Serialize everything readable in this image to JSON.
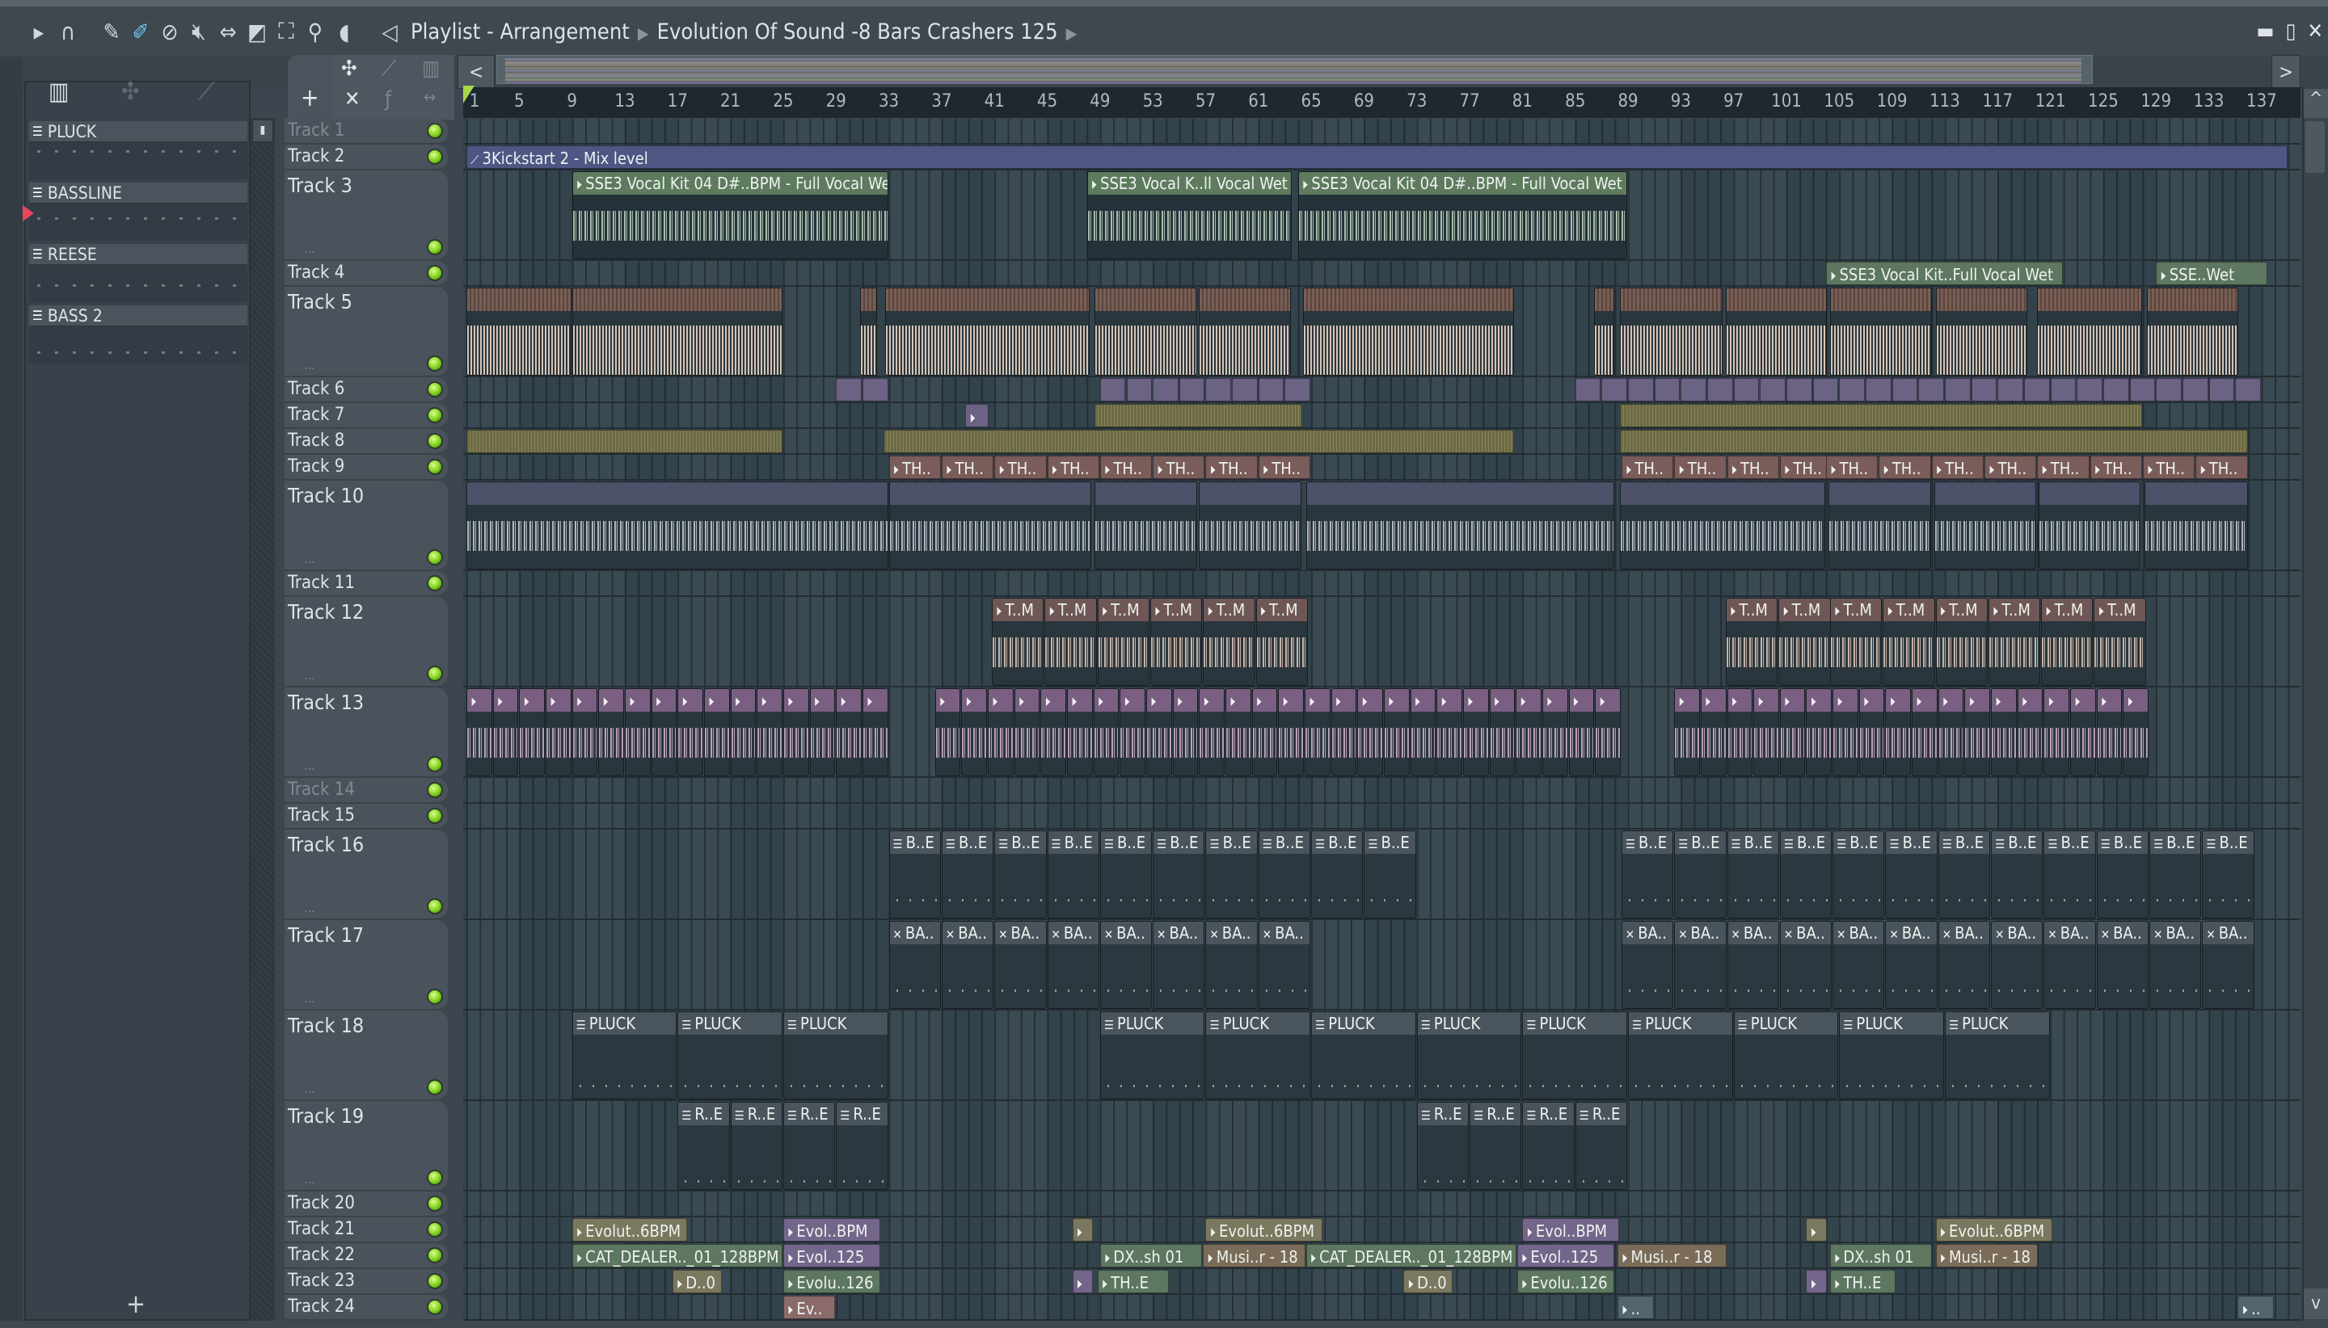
{
  "titlebar": {
    "title": "Playlist - Arrangement",
    "project": "Evolution Of Sound -8 Bars Crashers 125",
    "tools": [
      "play-icon",
      "magnet-icon",
      "pencil-icon",
      "paint-icon",
      "delete-icon",
      "mute-icon",
      "slip-icon",
      "slice-icon",
      "select-icon",
      "zoom-icon",
      "playback-icon"
    ],
    "window_buttons": [
      "minimize",
      "maximize",
      "close"
    ]
  },
  "pattern_picker": {
    "patterns": [
      {
        "name": "PLUCK"
      },
      {
        "name": "BASSLINE",
        "selected": true
      },
      {
        "name": "REESE"
      },
      {
        "name": "BASS 2"
      }
    ],
    "add_label": "+"
  },
  "toolbar2": {
    "add_label": "+",
    "scroll_left": "<",
    "scroll_right": ">"
  },
  "ruler": {
    "bars": [
      1,
      5,
      9,
      13,
      17,
      21,
      25,
      29,
      33,
      37,
      41,
      45,
      49,
      53,
      57,
      61,
      65,
      69,
      73,
      77,
      81,
      85,
      89,
      93,
      97,
      101,
      105,
      109,
      113,
      117,
      121,
      125,
      129,
      133,
      137
    ],
    "playhead_bar": 1
  },
  "colors": {
    "vocal": [
      "#5e7b5e",
      "#24323a",
      "#bed5bd"
    ],
    "auto": [
      "#4e5784",
      "#4e5784",
      "#4e5784"
    ],
    "kick": [
      "#6e5750",
      "#2a363d",
      "#d6c4b6"
    ],
    "t6": [
      "#6b6284",
      "#6b6284",
      "#6b6284"
    ],
    "olive": [
      "#6b6a45",
      "#6b6a45",
      "#6b6a45"
    ],
    "th": [
      "#7a5c5a",
      "#7a5c5a",
      "#7a5c5a"
    ],
    "t10": [
      "#4c5068",
      "#2a363d",
      "#c8ccd6"
    ],
    "t12": [
      "#6e5755",
      "#2a363d",
      "#e0c8b8"
    ],
    "t13": [
      "#7a5f82",
      "#2a363d",
      "#d0b0d0"
    ],
    "pat": [
      "#4a545d",
      "#2c383f",
      "#aab4ba"
    ],
    "ol2": [
      "#7a785e",
      "#7a785e",
      "#7a785e"
    ],
    "pur": [
      "#74668a",
      "#74668a",
      "#74668a"
    ],
    "grn": [
      "#5d7760",
      "#5d7760",
      "#5d7760"
    ],
    "brn": [
      "#7a6c58",
      "#7a6c58",
      "#7a6c58"
    ],
    "pnk": [
      "#8a6a6a",
      "#8a6a6a",
      "#8a6a6a"
    ],
    "teal": [
      "#52656d",
      "#52656d",
      "#52656d"
    ]
  },
  "tracks": [
    {
      "name": "Track 1",
      "dim": true,
      "tall": false,
      "clips": []
    },
    {
      "name": "Track 2",
      "tall": false,
      "clips": [
        {
          "s": 1,
          "l": 138,
          "t": "3Kickstart 2 - Mix level",
          "c": "auto",
          "i": "auto"
        }
      ]
    },
    {
      "name": "Track 3",
      "tall": true,
      "clips": [
        {
          "s": 9,
          "l": 24,
          "t": "SSE3 Vocal Kit 04 D#..BPM - Full Vocal Wet",
          "c": "vocal",
          "i": "audio"
        },
        {
          "s": 48,
          "l": 15.6,
          "t": "SSE3 Vocal K..ll Vocal Wet",
          "c": "vocal",
          "i": "audio"
        },
        {
          "s": 64,
          "l": 25,
          "t": "SSE3 Vocal Kit 04 D#..BPM - Full Vocal Wet",
          "c": "vocal",
          "i": "audio"
        }
      ]
    },
    {
      "name": "Track 4",
      "tall": false,
      "clips": [
        {
          "s": 104,
          "l": 18,
          "t": "SSE3 Vocal Kit..Full Vocal Wet",
          "c": "grn",
          "i": "audio"
        },
        {
          "s": 129,
          "l": 8.5,
          "t": "SSE..Wet",
          "c": "grn",
          "i": "audio"
        }
      ]
    },
    {
      "name": "Track 5",
      "tall": true,
      "clips": [
        {
          "s": 1,
          "l": 8,
          "t": "",
          "c": "kick"
        },
        {
          "s": 9,
          "l": 16,
          "t": "",
          "c": "kick"
        },
        {
          "s": 30.8,
          "l": 1.4,
          "t": "",
          "c": "kick"
        },
        {
          "s": 32.7,
          "l": 15.6,
          "t": "",
          "c": "kick"
        },
        {
          "s": 48.6,
          "l": 7.8,
          "t": "",
          "c": "kick"
        },
        {
          "s": 56.5,
          "l": 7,
          "t": "",
          "c": "kick"
        },
        {
          "s": 64.4,
          "l": 16,
          "t": "",
          "c": "kick"
        },
        {
          "s": 86.4,
          "l": 1.6,
          "t": "",
          "c": "kick"
        },
        {
          "s": 88.4,
          "l": 7.8,
          "t": "",
          "c": "kick"
        },
        {
          "s": 96.4,
          "l": 7.7,
          "t": "",
          "c": "kick"
        },
        {
          "s": 104.3,
          "l": 7.8,
          "t": "",
          "c": "kick"
        },
        {
          "s": 112.3,
          "l": 7,
          "t": "",
          "c": "kick"
        },
        {
          "s": 120,
          "l": 8,
          "t": "",
          "c": "kick"
        },
        {
          "s": 128.3,
          "l": 7,
          "t": "",
          "c": "kick"
        }
      ]
    },
    {
      "name": "Track 6",
      "tall": false,
      "runs": [
        {
          "s": 29,
          "l": 2,
          "n": 2,
          "c": "t6"
        },
        {
          "s": 49,
          "l": 2,
          "n": 8,
          "c": "t6"
        },
        {
          "s": 85,
          "l": 2,
          "n": 2,
          "c": "t6"
        },
        {
          "s": 89,
          "l": 2,
          "n": 24,
          "c": "t6"
        }
      ],
      "clips": []
    },
    {
      "name": "Track 7",
      "tall": false,
      "clips": [
        {
          "s": 38.8,
          "l": 1.8,
          "t": "",
          "c": "t6",
          "i": "audio"
        },
        {
          "s": 48.6,
          "l": 15.8,
          "t": "",
          "c": "olive"
        },
        {
          "s": 88.4,
          "l": 39.6,
          "t": "",
          "c": "olive"
        }
      ]
    },
    {
      "name": "Track 8",
      "tall": false,
      "clips": [
        {
          "s": 1,
          "l": 24,
          "t": "",
          "c": "olive"
        },
        {
          "s": 32.6,
          "l": 47.8,
          "t": "",
          "c": "olive"
        },
        {
          "s": 88.4,
          "l": 47.6,
          "t": "",
          "c": "olive"
        }
      ]
    },
    {
      "name": "Track 9",
      "tall": false,
      "runs": [
        {
          "s": 33,
          "l": 4,
          "n": 4,
          "t": "TH..",
          "c": "th",
          "i": "audio"
        },
        {
          "s": 49,
          "l": 4,
          "n": 4,
          "t": "TH..",
          "c": "th",
          "i": "audio"
        },
        {
          "s": 88.5,
          "l": 4,
          "n": 4,
          "t": "TH..",
          "c": "th",
          "i": "audio"
        },
        {
          "s": 104,
          "l": 4,
          "n": 8,
          "t": "TH..",
          "c": "th",
          "i": "audio"
        }
      ],
      "clips": []
    },
    {
      "name": "Track 10",
      "tall": true,
      "clips": [
        {
          "s": 1,
          "l": 32,
          "t": "",
          "c": "t10"
        },
        {
          "s": 33,
          "l": 15.4,
          "t": "",
          "c": "t10"
        },
        {
          "s": 48.6,
          "l": 7.8,
          "t": "",
          "c": "t10"
        },
        {
          "s": 56.5,
          "l": 7.8,
          "t": "",
          "c": "t10"
        },
        {
          "s": 64.6,
          "l": 23.4,
          "t": "",
          "c": "t10"
        },
        {
          "s": 88.4,
          "l": 15.6,
          "t": "",
          "c": "t10"
        },
        {
          "s": 104.2,
          "l": 7.8,
          "t": "",
          "c": "t10"
        },
        {
          "s": 112.2,
          "l": 7.8,
          "t": "",
          "c": "t10"
        },
        {
          "s": 120.1,
          "l": 7.8,
          "t": "",
          "c": "t10"
        },
        {
          "s": 128.1,
          "l": 7.9,
          "t": "",
          "c": "t10"
        }
      ]
    },
    {
      "name": "Track 11",
      "tall": false,
      "clips": []
    },
    {
      "name": "Track 12",
      "tall": true,
      "runs": [
        {
          "s": 40.8,
          "l": 4,
          "n": 2,
          "t": "T..M",
          "c": "t12",
          "i": "audio"
        },
        {
          "s": 48.8,
          "l": 4,
          "n": 4,
          "t": "T..M",
          "c": "t12",
          "i": "audio"
        },
        {
          "s": 96.4,
          "l": 4,
          "n": 2,
          "t": "T..M",
          "c": "t12",
          "i": "audio"
        },
        {
          "s": 104.3,
          "l": 4,
          "n": 6,
          "t": "T..M",
          "c": "t12",
          "i": "audio"
        }
      ],
      "clips": []
    },
    {
      "name": "Track 13",
      "tall": true,
      "runs": [
        {
          "s": 1,
          "l": 2,
          "n": 16,
          "t": "",
          "c": "t13",
          "i": "audio"
        },
        {
          "s": 36.5,
          "l": 2,
          "n": 26,
          "t": "",
          "c": "t13",
          "i": "audio"
        },
        {
          "s": 92.5,
          "l": 2,
          "n": 18,
          "t": "",
          "c": "t13",
          "i": "audio"
        }
      ],
      "clips": []
    },
    {
      "name": "Track 14",
      "dim": true,
      "tall": false,
      "clips": []
    },
    {
      "name": "Track 15",
      "tall": false,
      "clips": []
    },
    {
      "name": "Track 16",
      "tall": true,
      "runs": [
        {
          "s": 33,
          "l": 4,
          "n": 10,
          "t": "B..E",
          "c": "pat",
          "i": "pat"
        },
        {
          "s": 88.5,
          "l": 4,
          "n": 12,
          "t": "B..E",
          "c": "pat",
          "i": "pat"
        }
      ],
      "clips": []
    },
    {
      "name": "Track 17",
      "tall": true,
      "runs": [
        {
          "s": 33,
          "l": 4,
          "n": 8,
          "t": "BA..",
          "c": "pat",
          "i": "x"
        },
        {
          "s": 88.5,
          "l": 4,
          "n": 12,
          "t": "BA..",
          "c": "pat",
          "i": "x"
        }
      ],
      "clips": []
    },
    {
      "name": "Track 18",
      "tall": true,
      "runs": [
        {
          "s": 9,
          "l": 8,
          "n": 3,
          "t": "PLUCK",
          "c": "pat",
          "i": "pat"
        },
        {
          "s": 49,
          "l": 8,
          "n": 5,
          "t": "PLUCK",
          "c": "pat",
          "i": "pat"
        },
        {
          "s": 89,
          "l": 8,
          "n": 4,
          "t": "PLUCK",
          "c": "pat",
          "i": "pat"
        }
      ],
      "clips": []
    },
    {
      "name": "Track 19",
      "tall": true,
      "runs": [
        {
          "s": 17,
          "l": 4,
          "n": 4,
          "t": "R..E",
          "c": "pat",
          "i": "pat"
        },
        {
          "s": 73,
          "l": 4,
          "n": 4,
          "t": "R..E",
          "c": "pat",
          "i": "pat"
        }
      ],
      "clips": []
    },
    {
      "name": "Track 20",
      "tall": false,
      "clips": []
    },
    {
      "name": "Track 21",
      "tall": false,
      "clips": [
        {
          "s": 9,
          "l": 8.8,
          "t": "Evolut..6BPM",
          "c": "ol2",
          "i": "audio"
        },
        {
          "s": 25,
          "l": 7.4,
          "t": "Evol..BPM",
          "c": "pur",
          "i": "audio"
        },
        {
          "s": 46.9,
          "l": 1.6,
          "t": "",
          "c": "ol2",
          "i": "audio"
        },
        {
          "s": 57,
          "l": 8.9,
          "t": "Evolut..6BPM",
          "c": "ol2",
          "i": "audio"
        },
        {
          "s": 81,
          "l": 7.4,
          "t": "Evol..BPM",
          "c": "pur",
          "i": "audio"
        },
        {
          "s": 102.5,
          "l": 1.6,
          "t": "",
          "c": "ol2",
          "i": "audio"
        },
        {
          "s": 112.3,
          "l": 8.9,
          "t": "Evolut..6BPM",
          "c": "ol2",
          "i": "audio"
        }
      ]
    },
    {
      "name": "Track 22",
      "tall": false,
      "clips": [
        {
          "s": 9,
          "l": 16,
          "t": "CAT_DEALER.._01_128BPM",
          "c": "grn",
          "i": "audio"
        },
        {
          "s": 25,
          "l": 7.4,
          "t": "Evol..125",
          "c": "pur",
          "i": "audio"
        },
        {
          "s": 49,
          "l": 7.8,
          "t": "DX..sh 01",
          "c": "grn",
          "i": "audio"
        },
        {
          "s": 56.8,
          "l": 7.8,
          "t": "Musi..r - 18",
          "c": "brn",
          "i": "audio"
        },
        {
          "s": 64.6,
          "l": 16,
          "t": "CAT_DEALER.._01_128BPM",
          "c": "grn",
          "i": "audio"
        },
        {
          "s": 80.6,
          "l": 7.4,
          "t": "Evol..125",
          "c": "pur",
          "i": "audio"
        },
        {
          "s": 88.2,
          "l": 8.3,
          "t": "Musi..r - 18",
          "c": "brn",
          "i": "audio"
        },
        {
          "s": 104.3,
          "l": 7.8,
          "t": "DX..sh 01",
          "c": "grn",
          "i": "audio"
        },
        {
          "s": 112.3,
          "l": 7.8,
          "t": "Musi..r - 18",
          "c": "brn",
          "i": "audio"
        }
      ]
    },
    {
      "name": "Track 23",
      "tall": false,
      "clips": [
        {
          "s": 16.6,
          "l": 3.8,
          "t": "D..0",
          "c": "ol2",
          "i": "audio"
        },
        {
          "s": 25,
          "l": 7.4,
          "t": "Evolu..126",
          "c": "grn",
          "i": "audio"
        },
        {
          "s": 46.9,
          "l": 1.6,
          "t": "",
          "c": "pur",
          "i": "audio"
        },
        {
          "s": 48.8,
          "l": 5.5,
          "t": "TH..E",
          "c": "grn",
          "i": "audio"
        },
        {
          "s": 72,
          "l": 3.8,
          "t": "D..0",
          "c": "ol2",
          "i": "audio"
        },
        {
          "s": 80.6,
          "l": 7.4,
          "t": "Evolu..126",
          "c": "grn",
          "i": "audio"
        },
        {
          "s": 102.5,
          "l": 1.6,
          "t": "",
          "c": "pur",
          "i": "audio"
        },
        {
          "s": 104.3,
          "l": 5,
          "t": "TH..E",
          "c": "grn",
          "i": "audio"
        }
      ]
    },
    {
      "name": "Track 24",
      "tall": false,
      "clips": [
        {
          "s": 25,
          "l": 4,
          "t": "Ev..",
          "c": "pnk",
          "i": "audio"
        },
        {
          "s": 88.2,
          "l": 2.8,
          "t": "..",
          "c": "teal",
          "i": "audio"
        },
        {
          "s": 135.2,
          "l": 2.8,
          "t": "..",
          "c": "teal",
          "i": "audio"
        }
      ]
    }
  ]
}
